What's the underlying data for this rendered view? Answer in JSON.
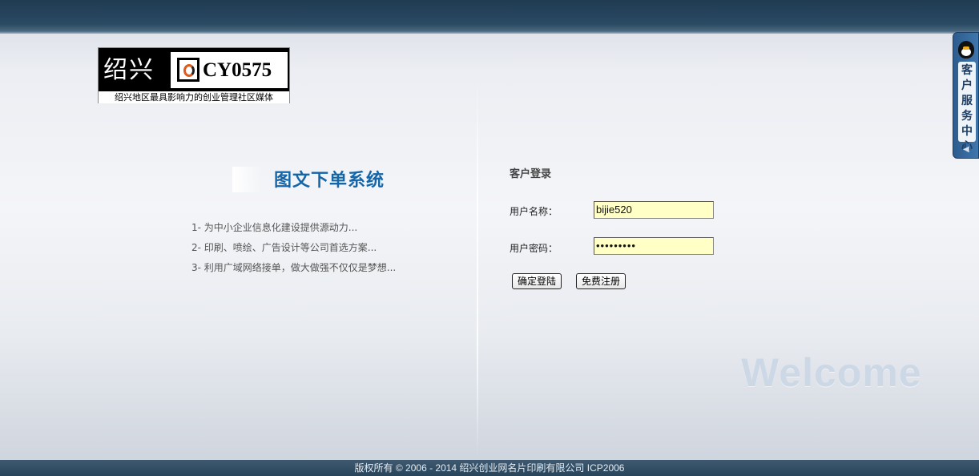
{
  "header": {},
  "logo": {
    "name_cn": "绍兴",
    "brand": "CY0575",
    "slogan": "绍兴地区最具影响力的创业管理社区媒体"
  },
  "system": {
    "title": "图文下单系统",
    "features": [
      "1- 为中小企业信息化建设提供源动力...",
      "2- 印刷、喷绘、广告设计等公司首选方案...",
      "3- 利用广域网络接单，做大做强不仅仅是梦想..."
    ]
  },
  "login": {
    "title": "客户登录",
    "username_label": "用户名称：",
    "username_value": "bijie520",
    "password_label": "用户密码：",
    "password_value": "•••••••••",
    "submit_label": "确定登陆",
    "register_label": "免费注册"
  },
  "welcome": "Welcome",
  "service": {
    "label": "客户服务中心",
    "icon": "qq-penguin-icon"
  },
  "footer": {
    "copyright": "版权所有 © 2006 - 2014 绍兴创业网名片印刷有限公司  ICP2006"
  },
  "colors": {
    "title_blue": "#1566a8",
    "input_bg": "#ffffc6",
    "topbar": "#1f3b52"
  }
}
